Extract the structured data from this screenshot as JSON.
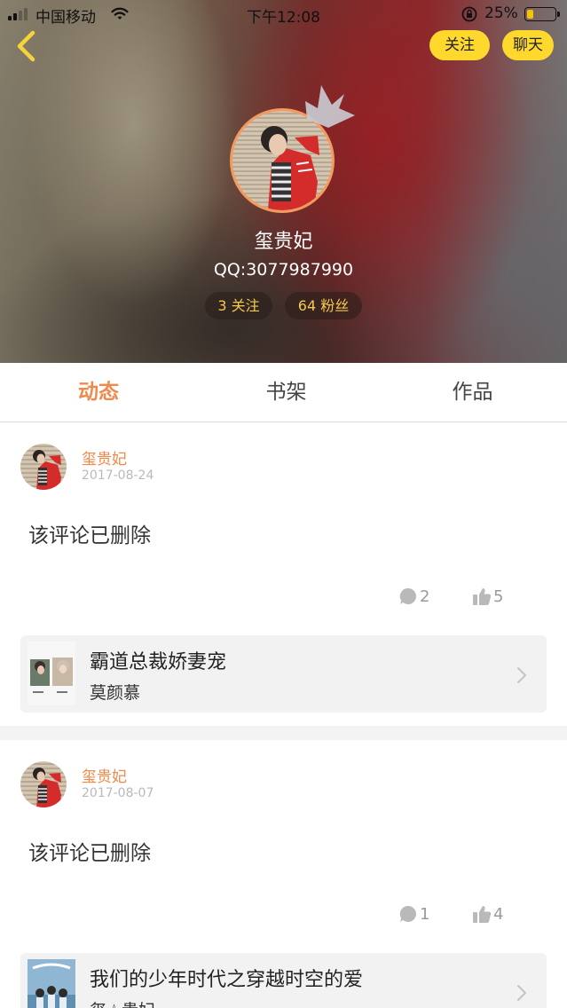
{
  "status_bar": {
    "carrier": "中国移动",
    "time": "下午12:08",
    "battery": "25%",
    "battery_level": 0.25
  },
  "nav": {
    "back_icon": "chevron-left-icon",
    "follow_label": "关注",
    "chat_label": "聊天"
  },
  "profile": {
    "name": "玺贵妃",
    "qq": "QQ:3077987990",
    "following": "3 关注",
    "fans": "64 粉丝"
  },
  "tabs": [
    {
      "label": "动态",
      "active": true
    },
    {
      "label": "书架",
      "active": false
    },
    {
      "label": "作品",
      "active": false
    }
  ],
  "posts": [
    {
      "author": "玺贵妃",
      "date": "2017-08-24",
      "body": "该评论已删除",
      "comments": "2",
      "likes": "5",
      "book": {
        "title": "霸道总裁娇妻宠",
        "author": "莫颜慕"
      }
    },
    {
      "author": "玺贵妃",
      "date": "2017-08-07",
      "body": "该评论已删除",
      "comments": "1",
      "likes": "4",
      "book": {
        "title": "我们的少年时代之穿越时空的爱",
        "author": "玺☆贵妃"
      }
    }
  ],
  "colors": {
    "accent": "#f08a4b",
    "button_yellow": "#ffd82e",
    "stat_text": "#f5c94d"
  }
}
